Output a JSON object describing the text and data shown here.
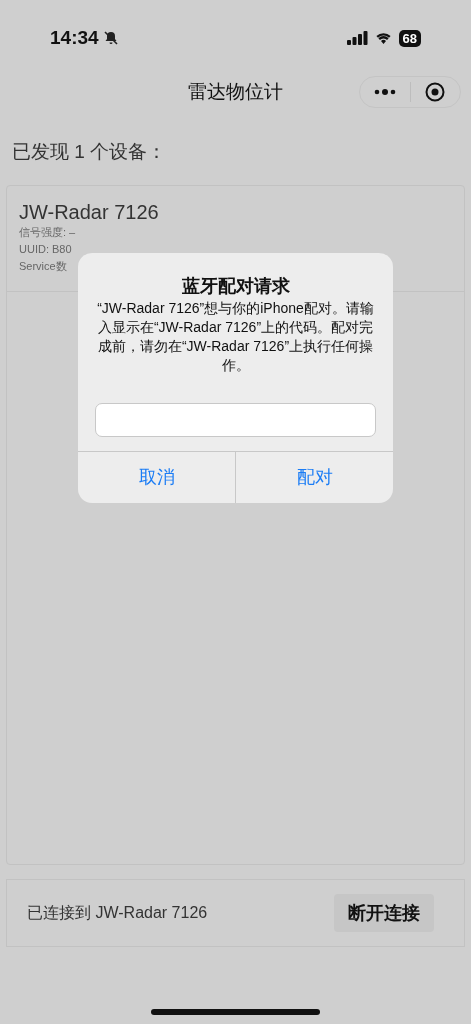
{
  "status_bar": {
    "time": "14:34",
    "silent": true,
    "battery": "68"
  },
  "nav": {
    "title": "雷达物位计"
  },
  "found_label": "已发现 1 个设备：",
  "device": {
    "name": "JW-Radar 7126",
    "lines": [
      "信号强度: –",
      "UUID: B80",
      "Service数"
    ]
  },
  "dialog": {
    "title": "蓝牙配对请求",
    "message": "“JW-Radar 7126”想与你的iPhone配对。请输入显示在“JW-Radar 7126”上的代码。配对完成前，请勿在“JW-Radar 7126”上执行任何操作。",
    "buttons": [
      "取消",
      "配对"
    ]
  },
  "connection": {
    "status": "已连接到 JW-Radar 7126",
    "button": "断开连接"
  }
}
